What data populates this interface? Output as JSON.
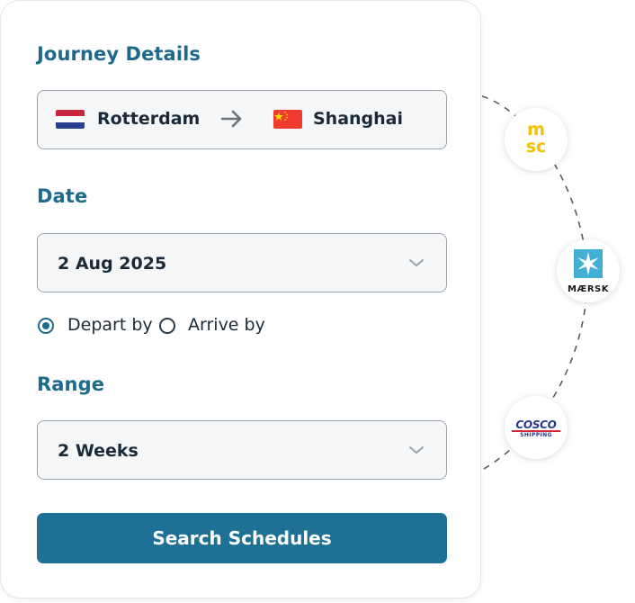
{
  "journey": {
    "title": "Journey Details",
    "origin": "Rotterdam",
    "destination": "Shanghai"
  },
  "date": {
    "title": "Date",
    "value": "2 Aug 2025",
    "options": [
      "Depart by",
      "Arrive by"
    ],
    "selected_option": "Depart by"
  },
  "range": {
    "title": "Range",
    "value": "2 Weeks"
  },
  "search_button_label": "Search Schedules",
  "carriers": [
    {
      "name": "MSC",
      "logo_text": "msc"
    },
    {
      "name": "Maersk",
      "logo_text": "MÆRSK"
    },
    {
      "name": "COSCO Shipping",
      "logo_text": "COSCO",
      "logo_subtext": "SHIPPING"
    }
  ],
  "colors": {
    "accent": "#1d6a8c",
    "button": "#1e7095",
    "field_bg": "#f5f6f7",
    "msc_yellow": "#f5c000",
    "maersk_blue": "#42b0d5",
    "cosco_blue": "#233a8c"
  }
}
